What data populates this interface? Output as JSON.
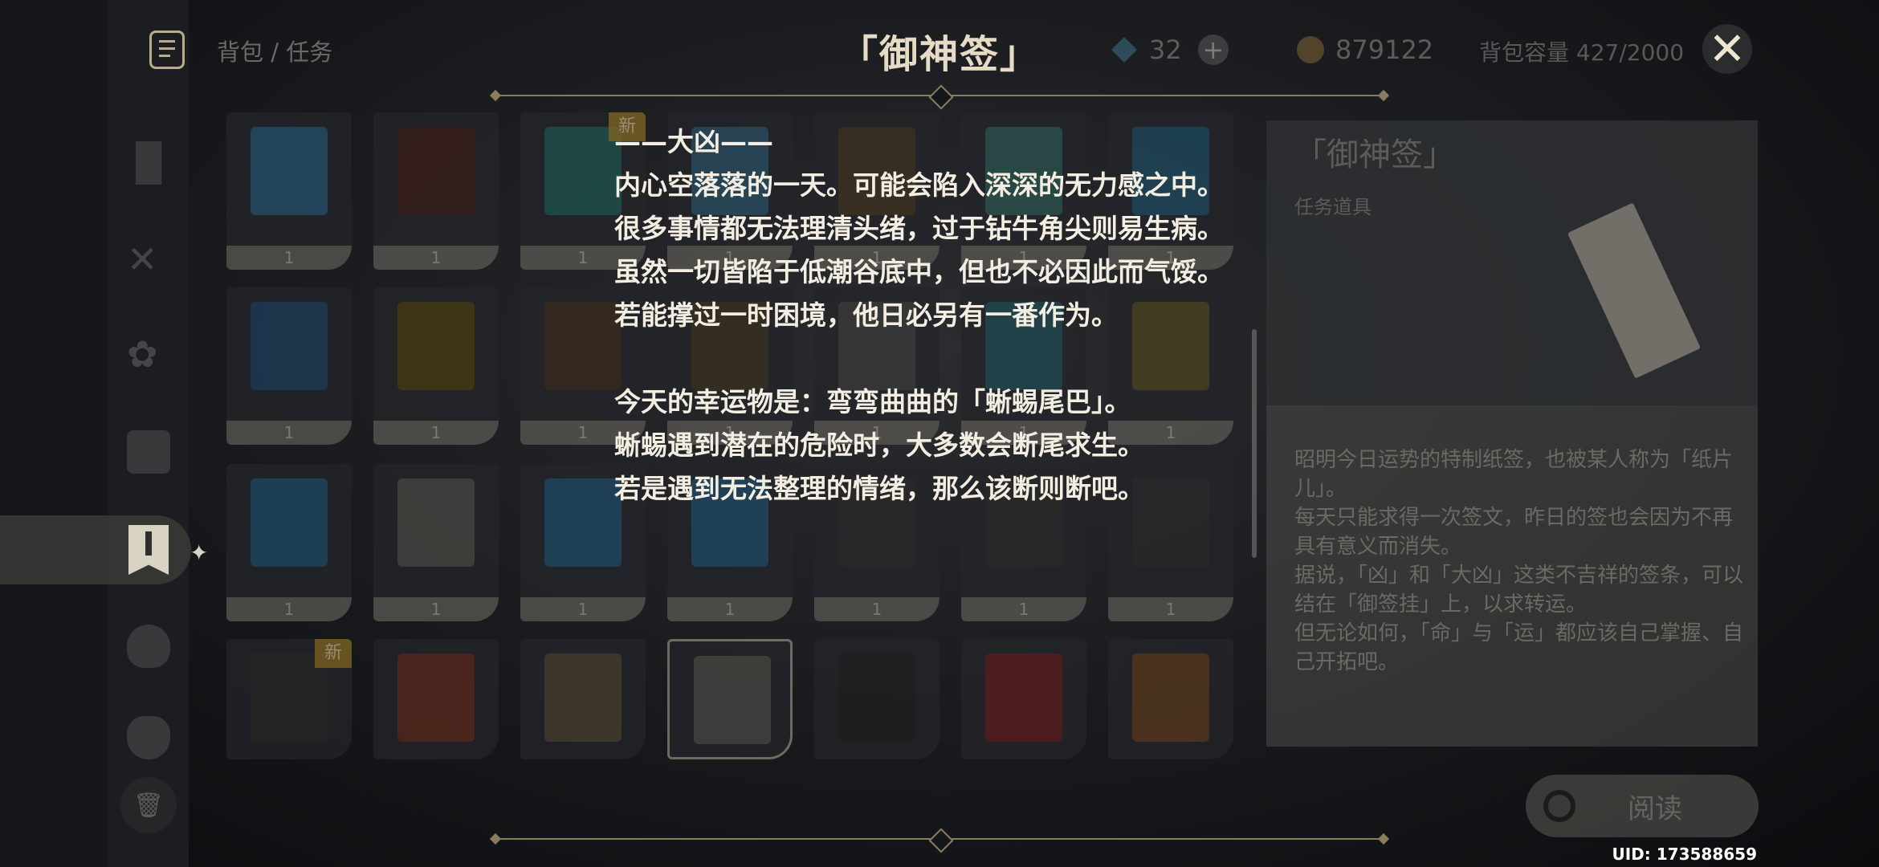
{
  "header": {
    "breadcrumb": "背包 / 任务",
    "primogems": "32",
    "mora": "879122",
    "capacity": "背包容量 427/2000"
  },
  "title": "「御神签」",
  "fortune": {
    "lines": [
      "——大凶——",
      "内心空落落的一天。可能会陷入深深的无力感之中。",
      "很多事情都无法理清头绪，过于钻牛角尖则易生病。",
      "虽然一切皆陷于低潮谷底中，但也不必因此而气馁。",
      "若能撑过一时困境，他日必另有一番作为。",
      "",
      "今天的幸运物是：弯弯曲曲的「蜥蜴尾巴」。",
      "蜥蜴遇到潜在的危险时，大多数会断尾求生。",
      "若是遇到无法整理的情绪，那么该断则断吧。"
    ]
  },
  "grid": {
    "badge": "新",
    "counts": [
      "1",
      "1",
      "1",
      "1",
      "1",
      "1",
      "1",
      "1",
      "1",
      "1",
      "1",
      "1",
      "1",
      "1",
      "1",
      "1",
      "1",
      "1",
      "1",
      "1",
      "1"
    ]
  },
  "detail": {
    "name": "「御神签」",
    "category": "任务道具",
    "description": "昭明今日运势的特制纸签，也被某人称为「纸片儿」。\n每天只能求得一次签文，昨日的签也会因为不再具有意义而消失。\n据说，「凶」和「大凶」这类不吉祥的签条，可以结在「御签挂」上，以求转运。\n但无论如何，「命」与「运」都应该自己掌握、自己开拓吧。",
    "read_button": "阅读"
  },
  "uid": "UID: 173588659",
  "colors": {
    "accent": "#d8c79c",
    "text": "#f4eee2"
  }
}
